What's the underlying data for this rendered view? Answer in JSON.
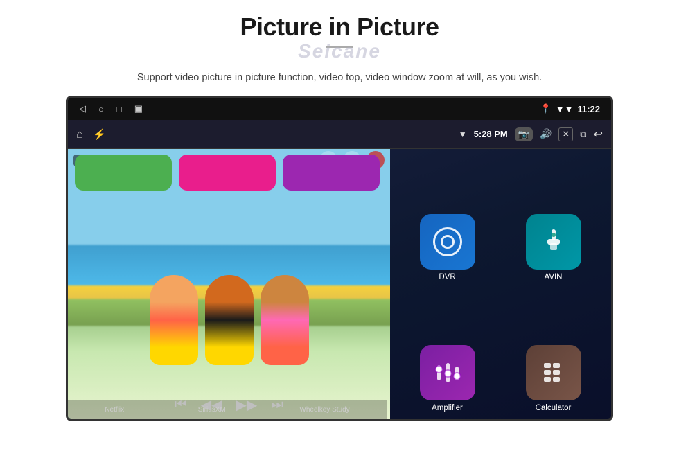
{
  "page": {
    "title": "Picture in Picture",
    "watermark": "Seicane",
    "subtitle": "Support video picture in picture function, video top, video window zoom at will, as you wish."
  },
  "statusbar": {
    "location_icon": "📍",
    "wifi_icon": "▼",
    "time": "11:22",
    "nav_back": "◁",
    "nav_home": "○",
    "nav_recent": "□",
    "nav_app": "▣"
  },
  "topbar": {
    "home_icon": "⌂",
    "usb_icon": "⚡",
    "wifi_signal": "▼",
    "time": "5:28 PM",
    "camera_icon": "📷",
    "volume_icon": "🔊",
    "close_icon": "✕",
    "window_icon": "⧉",
    "back_icon": "↩"
  },
  "pip": {
    "play_icon": "▶",
    "minimize_label": "—",
    "expand_label": "+",
    "close_label": "✕",
    "prev_label": "⏮",
    "rewind_label": "◀◀",
    "forward_label": "▶▶",
    "next_label": "⏭"
  },
  "apps": {
    "row1": [
      {
        "id": "netflix",
        "label": "Netflix",
        "color": "partial-green",
        "icon": "N"
      },
      {
        "id": "siriusxm",
        "label": "SiriusXM",
        "color": "partial-pink",
        "icon": "S"
      },
      {
        "id": "wheelkey",
        "label": "Wheelkey Study",
        "color": "partial-purple",
        "icon": "W"
      }
    ],
    "row2": [
      {
        "id": "dvr",
        "label": "DVR",
        "color": "dvr-blue"
      },
      {
        "id": "avin",
        "label": "AVIN",
        "color": "avin-teal"
      }
    ],
    "row3": [
      {
        "id": "amplifier",
        "label": "Amplifier",
        "color": "amplifier-purple"
      },
      {
        "id": "calculator",
        "label": "Calculator",
        "color": "calculator-brown"
      }
    ]
  },
  "bottom_labels": {
    "netflix": "Netflix",
    "siriusxm": "SiriusXM",
    "wheelkey": "Wheelkey Study",
    "amplifier": "Amplifier",
    "calculator": "Calculator"
  }
}
